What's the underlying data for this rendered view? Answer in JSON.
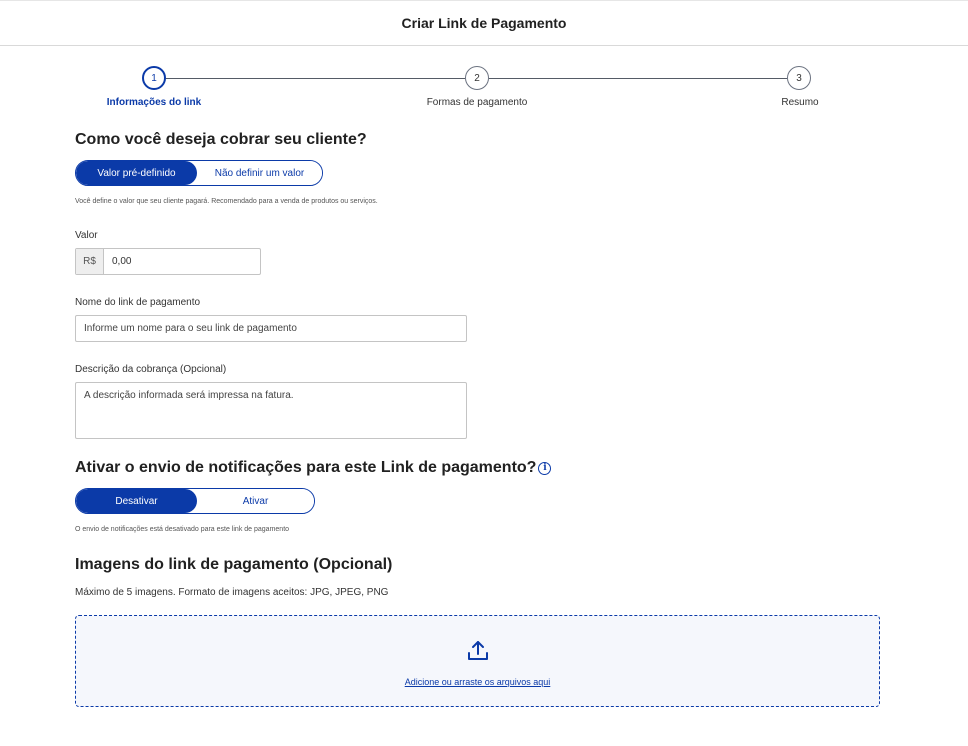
{
  "header": {
    "title": "Criar Link de Pagamento"
  },
  "stepper": {
    "steps": [
      {
        "number": "1",
        "label": "Informações do link"
      },
      {
        "number": "2",
        "label": "Formas de pagamento"
      },
      {
        "number": "3",
        "label": "Resumo"
      }
    ]
  },
  "charge": {
    "title": "Como você deseja cobrar seu cliente?",
    "options": [
      "Valor pré-definido",
      "Não definir um valor"
    ],
    "hint": "Você define o valor que seu cliente pagará. Recomendado para a venda de produtos ou serviços."
  },
  "valor": {
    "label": "Valor",
    "prefix": "R$",
    "value": "0,00"
  },
  "nome": {
    "label": "Nome do link de pagamento",
    "placeholder": "Informe um nome para o seu link de pagamento"
  },
  "descricao": {
    "label": "Descrição da cobrança (Opcional)",
    "placeholder": "A descrição informada será impressa na fatura."
  },
  "notifications": {
    "title": "Ativar o envio de notificações para este Link de pagamento?",
    "info_glyph": "i",
    "options": [
      "Desativar",
      "Ativar"
    ],
    "hint": "O envio de notificações está desativado para este link de pagamento"
  },
  "images": {
    "title": "Imagens do link de pagamento (Opcional)",
    "subtitle": "Máximo de 5 imagens. Formato de imagens aceitos: JPG, JPEG, PNG",
    "upload_link": "Adicione ou arraste os arquivos aqui",
    "icon": "upload-icon"
  },
  "colors": {
    "primary": "#0b3aa8",
    "border": "#c4c4c4"
  }
}
